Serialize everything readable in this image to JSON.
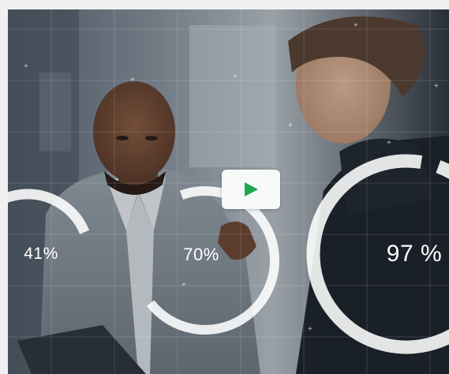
{
  "video": {
    "play_icon": "play-icon",
    "accent_color": "#1fa84f"
  },
  "stats": [
    {
      "label": "41%",
      "value": 41
    },
    {
      "label": "70%",
      "value": 70
    },
    {
      "label": "97 %",
      "value": 97
    }
  ]
}
